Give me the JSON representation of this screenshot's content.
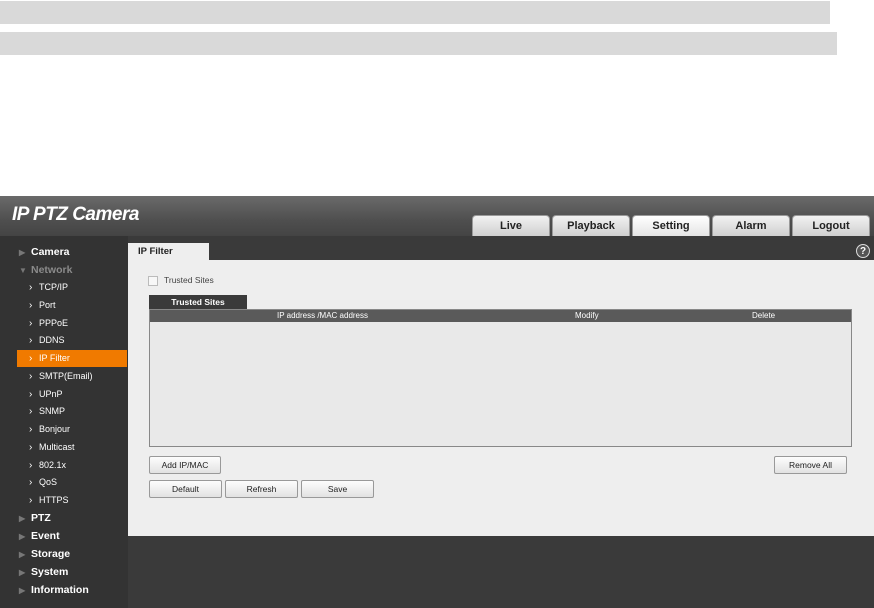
{
  "app_title": "IP PTZ Camera",
  "nav_tabs": [
    "Live",
    "Playback",
    "Setting",
    "Alarm",
    "Logout"
  ],
  "sidebar": {
    "camera": "Camera",
    "network": "Network",
    "network_items": [
      "TCP/IP",
      "Port",
      "PPPoE",
      "DDNS",
      "IP Filter",
      "SMTP(Email)",
      "UPnP",
      "SNMP",
      "Bonjour",
      "Multicast",
      "802.1x",
      "QoS",
      "HTTPS"
    ],
    "ptz": "PTZ",
    "event": "Event",
    "storage": "Storage",
    "system": "System",
    "information": "Information"
  },
  "page": {
    "tab": "IP Filter",
    "help_icon": "?",
    "trusted_sites_label": "Trusted Sites",
    "sub_tab": "Trusted Sites",
    "columns": [
      "IP address /MAC address",
      "Modify",
      "Delete"
    ],
    "add_button": "Add IP/MAC",
    "remove_all_button": "Remove All",
    "default_button": "Default",
    "refresh_button": "Refresh",
    "save_button": "Save"
  },
  "colors": {
    "accent": "#f07a00",
    "background": "#3a3a3a"
  }
}
